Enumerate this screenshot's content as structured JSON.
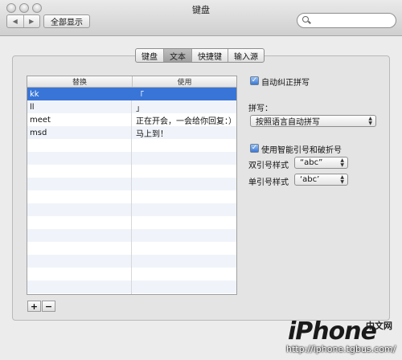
{
  "window": {
    "title": "键盘"
  },
  "toolbar": {
    "back_icon": "◀",
    "forward_icon": "▶",
    "show_all_label": "全部显示",
    "search_placeholder": ""
  },
  "tabs": [
    {
      "label": "键盘",
      "active": false
    },
    {
      "label": "文本",
      "active": true
    },
    {
      "label": "快捷键",
      "active": false
    },
    {
      "label": "输入源",
      "active": false
    }
  ],
  "table": {
    "headers": [
      "替换",
      "使用"
    ],
    "rows": [
      [
        "kk",
        "「"
      ],
      [
        "ll",
        "」"
      ],
      [
        "meet",
        "正在开会，一会给你回复：）"
      ],
      [
        "msd",
        "马上到！"
      ]
    ],
    "selected_row": 0
  },
  "buttons": {
    "add": "+",
    "remove": "−"
  },
  "options": {
    "autocorrect": {
      "label": "自动纠正拼写",
      "checked": true
    },
    "spelling_label": "拼写：",
    "spelling_value": "按照语言自动拼写",
    "smart_quotes": {
      "label": "使用智能引号和破折号",
      "checked": true
    },
    "double_quote_label": "双引号样式",
    "double_quote_value": "“abc”",
    "single_quote_label": "单引号样式",
    "single_quote_value": "‘abc’"
  },
  "watermark": {
    "logo": "iPhone",
    "cn": "中文网",
    "url": "http://iphone.tgbus.com/"
  },
  "colors": {
    "selection": "#3875d7",
    "checkbox": "#3a78d4"
  }
}
